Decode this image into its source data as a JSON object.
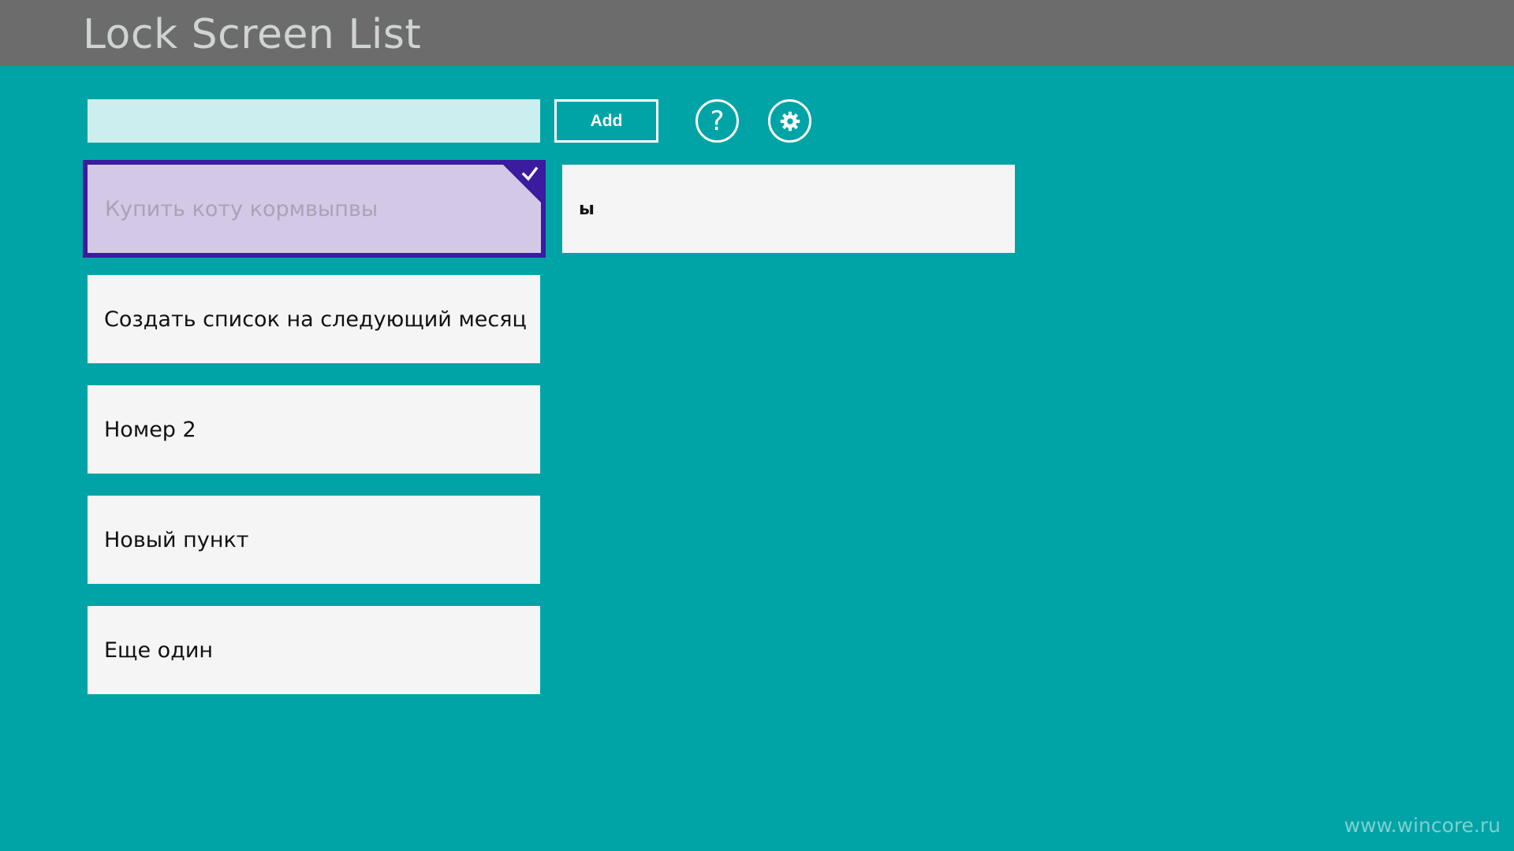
{
  "app": {
    "title": "Lock Screen List",
    "background_color": "#00a4a6",
    "titlebar_color": "#6c6c6c",
    "accent_color": "#3b1c9e"
  },
  "toolbar": {
    "input_value": "",
    "input_placeholder": "",
    "add_label": "Add",
    "help_icon": "question-mark-icon",
    "settings_icon": "gear-icon"
  },
  "list": {
    "items": [
      {
        "label": "Купить коту кормвыпвы",
        "selected": true
      },
      {
        "label": "Создать список на следующий месяц",
        "selected": false
      },
      {
        "label": "Номер 2",
        "selected": false
      },
      {
        "label": "Новый пункт",
        "selected": false
      },
      {
        "label": "Еще один",
        "selected": false
      }
    ]
  },
  "detail": {
    "text": "ы"
  },
  "watermark": "www.wincore.ru"
}
